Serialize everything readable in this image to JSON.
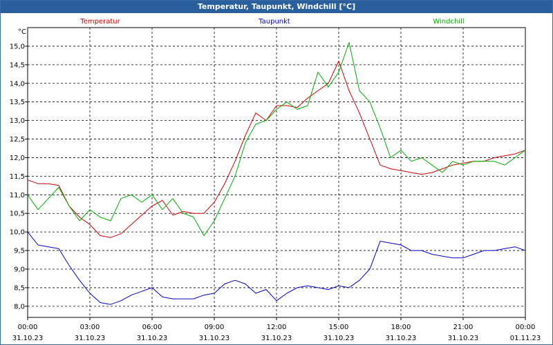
{
  "window": {
    "title": "Temperatur, Taupunkt, Windchill [°C]"
  },
  "colors": {
    "temperatur": "#cc0000",
    "taupunkt": "#0000cc",
    "windchill": "#00aa00",
    "titlebar": "#2a5f9e"
  },
  "chart_data": {
    "type": "line",
    "title": "Temperatur, Taupunkt, Windchill [°C]",
    "ylabel": "°C",
    "ylim": [
      7.7,
      15.5
    ],
    "xlim": [
      0,
      24
    ],
    "grid": true,
    "legend": "top",
    "yticks": [
      "8,0",
      "8,5",
      "9,0",
      "9,5",
      "10,0",
      "10,5",
      "11,0",
      "11,5",
      "12,0",
      "12,5",
      "13,0",
      "13,5",
      "14,0",
      "14,5",
      "15,0"
    ],
    "xticks": [
      {
        "time": "00:00",
        "date": "31.10.23"
      },
      {
        "time": "03:00",
        "date": "31.10.23"
      },
      {
        "time": "06:00",
        "date": "31.10.23"
      },
      {
        "time": "09:00",
        "date": "31.10.23"
      },
      {
        "time": "12:00",
        "date": "31.10.23"
      },
      {
        "time": "15:00",
        "date": "31.10.23"
      },
      {
        "time": "18:00",
        "date": "31.10.23"
      },
      {
        "time": "21:00",
        "date": "31.10.23"
      },
      {
        "time": "00:00",
        "date": "01.11.23"
      }
    ],
    "series": [
      {
        "name": "Temperatur",
        "x": [
          0,
          0.5,
          1,
          1.5,
          2,
          2.5,
          3,
          3.5,
          4,
          4.5,
          5,
          5.5,
          6,
          6.5,
          7,
          7.5,
          8,
          8.5,
          9,
          9.5,
          10,
          10.5,
          11,
          11.5,
          12,
          12.5,
          13,
          13.5,
          14,
          14.5,
          15,
          15.5,
          16,
          16.5,
          17,
          17.5,
          18,
          18.5,
          19,
          19.5,
          20,
          20.5,
          21,
          21.5,
          22,
          22.5,
          23,
          23.5,
          24
        ],
        "values": [
          11.4,
          11.3,
          11.3,
          11.25,
          10.7,
          10.4,
          10.2,
          9.9,
          9.85,
          9.95,
          10.2,
          10.45,
          10.7,
          10.85,
          10.45,
          10.55,
          10.5,
          10.5,
          10.8,
          11.3,
          11.9,
          12.6,
          13.2,
          13.0,
          13.4,
          13.4,
          13.35,
          13.6,
          13.8,
          14.0,
          14.6,
          13.8,
          13.2,
          12.5,
          11.8,
          11.7,
          11.65,
          11.6,
          11.55,
          11.6,
          11.7,
          11.8,
          11.85,
          11.9,
          11.9,
          12.0,
          12.05,
          12.1,
          12.2
        ]
      },
      {
        "name": "Taupunkt",
        "x": [
          0,
          0.5,
          1,
          1.5,
          2,
          2.5,
          3,
          3.5,
          4,
          4.5,
          5,
          5.5,
          6,
          6.5,
          7,
          7.5,
          8,
          8.5,
          9,
          9.5,
          10,
          10.5,
          11,
          11.5,
          12,
          12.5,
          13,
          13.5,
          14,
          14.5,
          15,
          15.5,
          16,
          16.5,
          17,
          17.5,
          18,
          18.5,
          19,
          19.5,
          20,
          20.5,
          21,
          21.5,
          22,
          22.5,
          23,
          23.5,
          24
        ],
        "values": [
          10.0,
          9.65,
          9.6,
          9.55,
          9.1,
          8.7,
          8.35,
          8.1,
          8.05,
          8.15,
          8.3,
          8.4,
          8.5,
          8.25,
          8.2,
          8.2,
          8.2,
          8.3,
          8.35,
          8.6,
          8.7,
          8.6,
          8.35,
          8.45,
          8.15,
          8.35,
          8.5,
          8.55,
          8.5,
          8.45,
          8.55,
          8.5,
          8.7,
          9.0,
          9.75,
          9.7,
          9.65,
          9.5,
          9.5,
          9.4,
          9.35,
          9.3,
          9.3,
          9.4,
          9.5,
          9.5,
          9.55,
          9.6,
          9.5
        ]
      },
      {
        "name": "Windchill",
        "x": [
          0,
          0.5,
          1,
          1.5,
          2,
          2.5,
          3,
          3.5,
          4,
          4.5,
          5,
          5.5,
          6,
          6.5,
          7,
          7.5,
          8,
          8.5,
          9,
          9.5,
          10,
          10.5,
          11,
          11.5,
          12,
          12.5,
          13,
          13.5,
          14,
          14.5,
          15,
          15.5,
          16,
          16.5,
          17,
          17.5,
          18,
          18.5,
          19,
          19.5,
          20,
          20.5,
          21,
          21.5,
          22,
          22.5,
          23,
          23.5,
          24
        ],
        "values": [
          11.0,
          10.6,
          10.9,
          11.2,
          10.7,
          10.3,
          10.6,
          10.4,
          10.3,
          10.9,
          11.0,
          10.8,
          11.0,
          10.6,
          10.9,
          10.5,
          10.4,
          9.9,
          10.3,
          10.9,
          11.5,
          12.4,
          12.9,
          13.0,
          13.3,
          13.5,
          13.3,
          13.4,
          14.3,
          13.9,
          14.3,
          15.1,
          13.8,
          13.5,
          12.8,
          12.0,
          12.2,
          11.9,
          12.0,
          11.8,
          11.6,
          11.9,
          11.8,
          11.9,
          11.9,
          11.9,
          11.8,
          12.0,
          12.2
        ]
      }
    ]
  }
}
